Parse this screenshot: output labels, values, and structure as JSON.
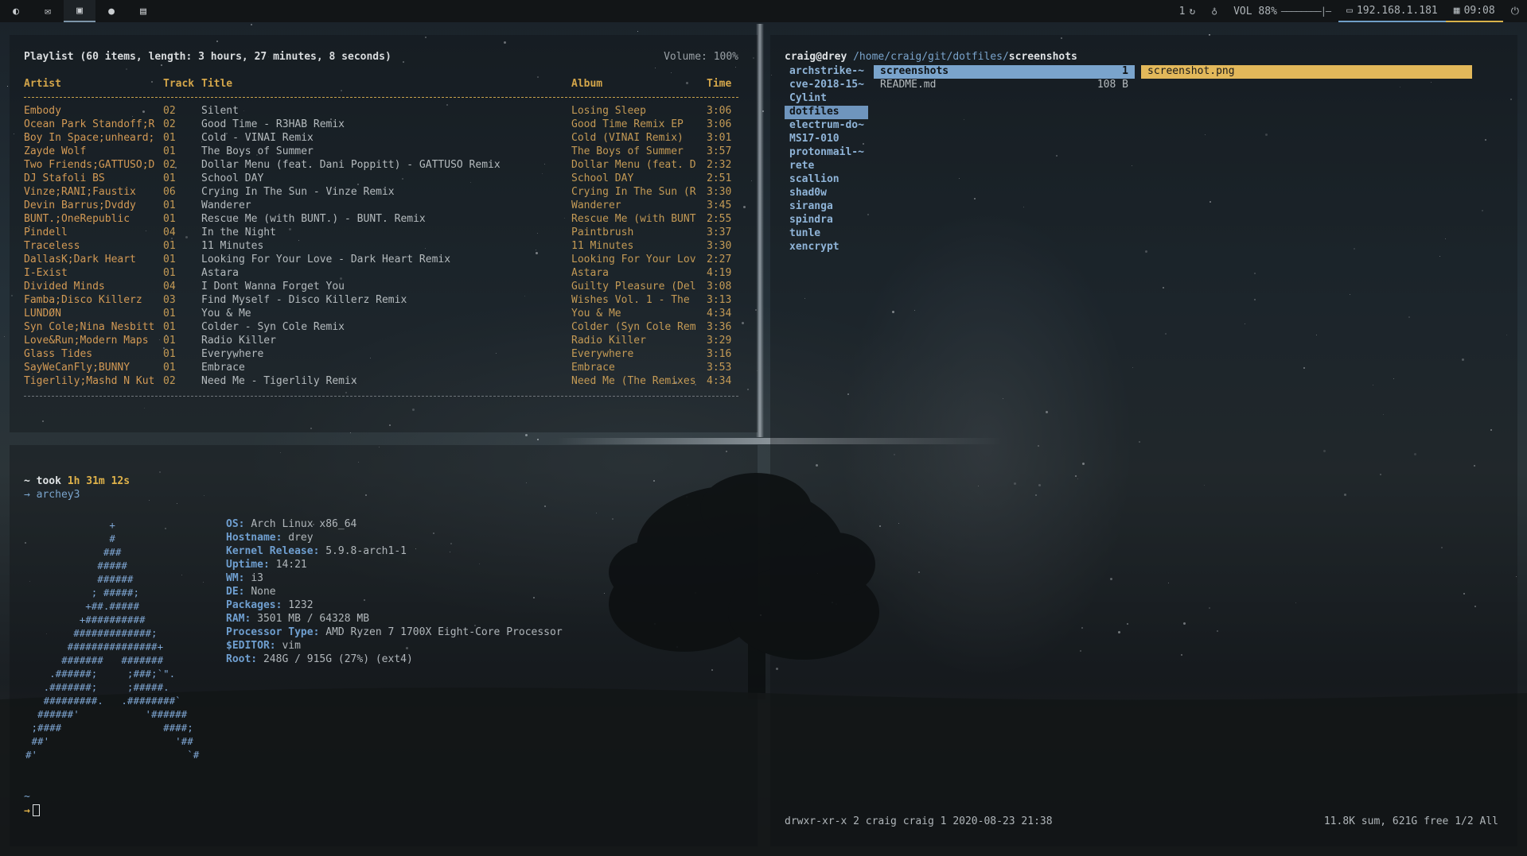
{
  "topbar": {
    "workspace_icons": [
      "moon-icon",
      "mail-icon",
      "terminal-icon",
      "user-icon",
      "image-icon"
    ],
    "updates": "1",
    "volume_label": "VOL 88%",
    "volume_level": 0.88,
    "ip": "192.168.1.181",
    "clock": "09:08"
  },
  "playlist": {
    "header": "Playlist (60 items, length: 3 hours, 27 minutes, 8 seconds)",
    "volume": "Volume: 100%",
    "columns": {
      "artist": "Artist",
      "track": "Track",
      "title": "Title",
      "album": "Album",
      "time": "Time"
    },
    "rows": [
      {
        "artist": "Embody",
        "track": "02",
        "title": "Silent",
        "album": "Losing Sleep",
        "time": "3:06"
      },
      {
        "artist": "Ocean Park Standoff;R",
        "track": "02",
        "title": "Good Time - R3HAB Remix",
        "album": "Good Time Remix EP",
        "time": "3:06"
      },
      {
        "artist": "Boy In Space;unheard;",
        "track": "01",
        "title": "Cold - VINAI Remix",
        "album": "Cold (VINAI Remix)",
        "time": "3:01"
      },
      {
        "artist": "Zayde Wolf",
        "track": "01",
        "title": "The Boys of Summer",
        "album": "The Boys of Summer",
        "time": "3:57"
      },
      {
        "artist": "Two Friends;GATTÜSO;D",
        "track": "02",
        "title": "Dollar Menu (feat. Dani Poppitt) - GATTÜSO Remix",
        "album": "Dollar Menu (feat. D",
        "time": "2:32"
      },
      {
        "artist": "DJ Stafoli BS",
        "track": "01",
        "title": "School DAY",
        "album": "School DAY",
        "time": "2:51"
      },
      {
        "artist": "Vinze;RANI;Faustix",
        "track": "06",
        "title": "Crying In The Sun - Vinze Remix",
        "album": "Crying In The Sun (R",
        "time": "3:30"
      },
      {
        "artist": "Devin Barrus;Dvddy",
        "track": "01",
        "title": "Wanderer",
        "album": "Wanderer",
        "time": "3:45"
      },
      {
        "artist": "BUNT.;OneRepublic",
        "track": "01",
        "title": "Rescue Me (with BUNT.) - BUNT. Remix",
        "album": "Rescue Me (with BUNT",
        "time": "2:55"
      },
      {
        "artist": "Pindell",
        "track": "04",
        "title": "In the Night",
        "album": "Paintbrush",
        "time": "3:37"
      },
      {
        "artist": "Traceless",
        "track": "01",
        "title": "11 Minutes",
        "album": "11 Minutes",
        "time": "3:30"
      },
      {
        "artist": "DallasK;Dark Heart",
        "track": "01",
        "title": "Looking For Your Love - Dark Heart Remix",
        "album": "Looking For Your Lov",
        "time": "2:27"
      },
      {
        "artist": "I-Exist",
        "track": "01",
        "title": "Astara",
        "album": "Astara",
        "time": "4:19"
      },
      {
        "artist": "Divided Minds",
        "track": "04",
        "title": "I Dont Wanna Forget You",
        "album": "Guilty Pleasure (Del",
        "time": "3:08"
      },
      {
        "artist": "Famba;Disco Killerz",
        "track": "03",
        "title": "Find Myself - Disco Killerz Remix",
        "album": "Wishes Vol. 1 - The",
        "time": "3:13"
      },
      {
        "artist": "LUNDØN",
        "track": "01",
        "title": "You & Me",
        "album": "You & Me",
        "time": "4:34"
      },
      {
        "artist": "Syn Cole;Nina Nesbitt",
        "track": "01",
        "title": "Colder - Syn Cole Remix",
        "album": "Colder (Syn Cole Rem",
        "time": "3:36"
      },
      {
        "artist": "Love&Run;Modern Maps",
        "track": "01",
        "title": "Radio Killer",
        "album": "Radio Killer",
        "time": "3:29"
      },
      {
        "artist": "Glass Tides",
        "track": "01",
        "title": "Everywhere",
        "album": "Everywhere",
        "time": "3:16"
      },
      {
        "artist": "SayWeCanFly;BUNNY",
        "track": "01",
        "title": "Embrace",
        "album": "Embrace",
        "time": "3:53"
      },
      {
        "artist": "Tigerlily;Mashd N Kut",
        "track": "02",
        "title": "Need Me - Tigerlily Remix",
        "album": "Need Me (The Remixes",
        "time": "4:34"
      }
    ]
  },
  "terminal": {
    "took_prefix": "~ took",
    "took_value": "1h 31m 12s",
    "command_prompt": "→ archey3",
    "info": [
      {
        "key": "OS:",
        "value": "Arch Linux x86_64"
      },
      {
        "key": "Hostname:",
        "value": "drey"
      },
      {
        "key": "Kernel Release:",
        "value": "5.9.8-arch1-1"
      },
      {
        "key": "Uptime:",
        "value": "14:21"
      },
      {
        "key": "WM:",
        "value": "i3"
      },
      {
        "key": "DE:",
        "value": "None"
      },
      {
        "key": "Packages:",
        "value": "1232"
      },
      {
        "key": "RAM:",
        "value": "3501 MB / 64328 MB"
      },
      {
        "key": "Processor Type:",
        "value": "AMD Ryzen 7 1700X Eight-Core Processor"
      },
      {
        "key": "$EDITOR:",
        "value": "vim"
      },
      {
        "key": "Root:",
        "value": "248G / 915G (27%) (ext4)"
      }
    ],
    "tilde": "~",
    "prompt_arrow": "→"
  },
  "ranger": {
    "path_host": "craig@drey",
    "path_dir": "/home/craig/git/dotfiles/",
    "path_leaf": "screenshots",
    "col1": [
      "archstrike-~",
      "cve-2018-15~",
      "Cylint",
      "dotfiles",
      "electrum-do~",
      "MS17-010",
      "protonmail-~",
      "rete",
      "scallion",
      "shad0w",
      "siranga",
      "spindra",
      "tunle",
      "xencrypt"
    ],
    "col1_selected": 3,
    "col2": [
      {
        "name": "screenshots",
        "size": "1",
        "selected": true
      },
      {
        "name": "README.md",
        "size": "108 B",
        "selected": false
      }
    ],
    "col3": [
      "screenshot.png"
    ],
    "status_left": "drwxr-xr-x 2 craig craig 1 2020-08-23 21:38",
    "status_right": "11.8K sum, 621G free  1/2  All"
  },
  "colors": {
    "accent_yellow": "#d4a64a",
    "accent_blue": "#7aa4cc",
    "bar_bg": "#121517"
  }
}
